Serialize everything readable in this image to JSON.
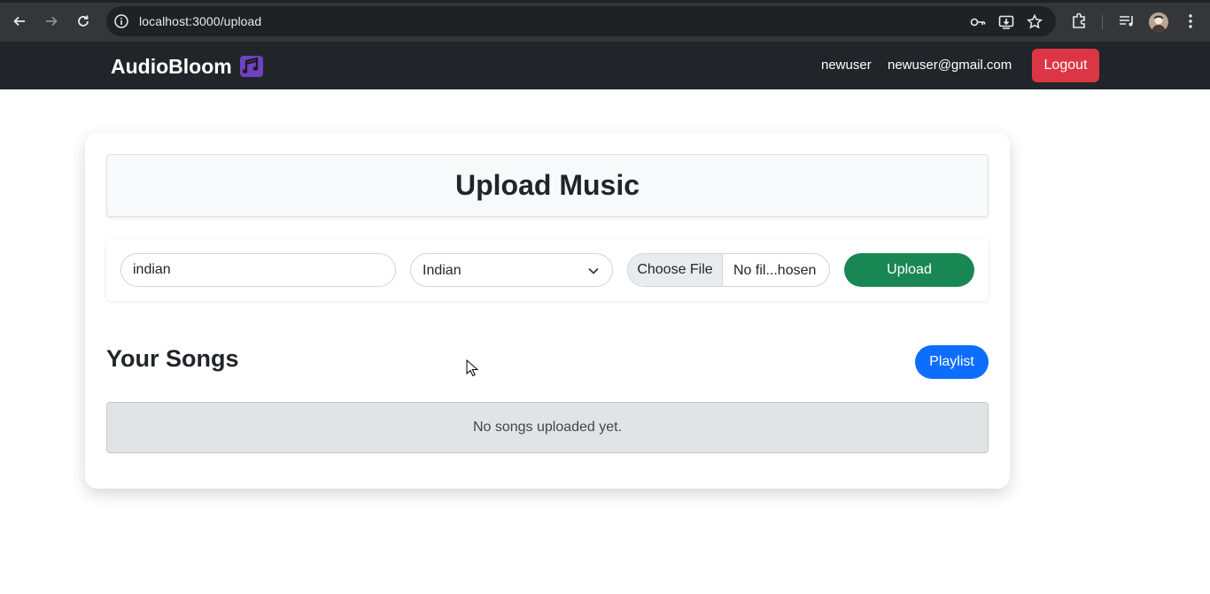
{
  "browser": {
    "url": "localhost:3000/upload"
  },
  "navbar": {
    "brand": "AudioBloom",
    "brand_icon": "music-notes-icon",
    "username": "newuser",
    "email": "newuser@gmail.com",
    "logout_label": "Logout",
    "logout_color": "#dc3545"
  },
  "upload": {
    "title": "Upload Music",
    "song_name_value": "indian",
    "genre_selected": "Indian",
    "file_button_label": "Choose File",
    "file_status": "No fil...hosen",
    "upload_label": "Upload",
    "upload_color": "#198754"
  },
  "songs": {
    "heading": "Your Songs",
    "playlist_label": "Playlist",
    "playlist_color": "#0d6efd",
    "empty_message": "No songs uploaded yet."
  }
}
